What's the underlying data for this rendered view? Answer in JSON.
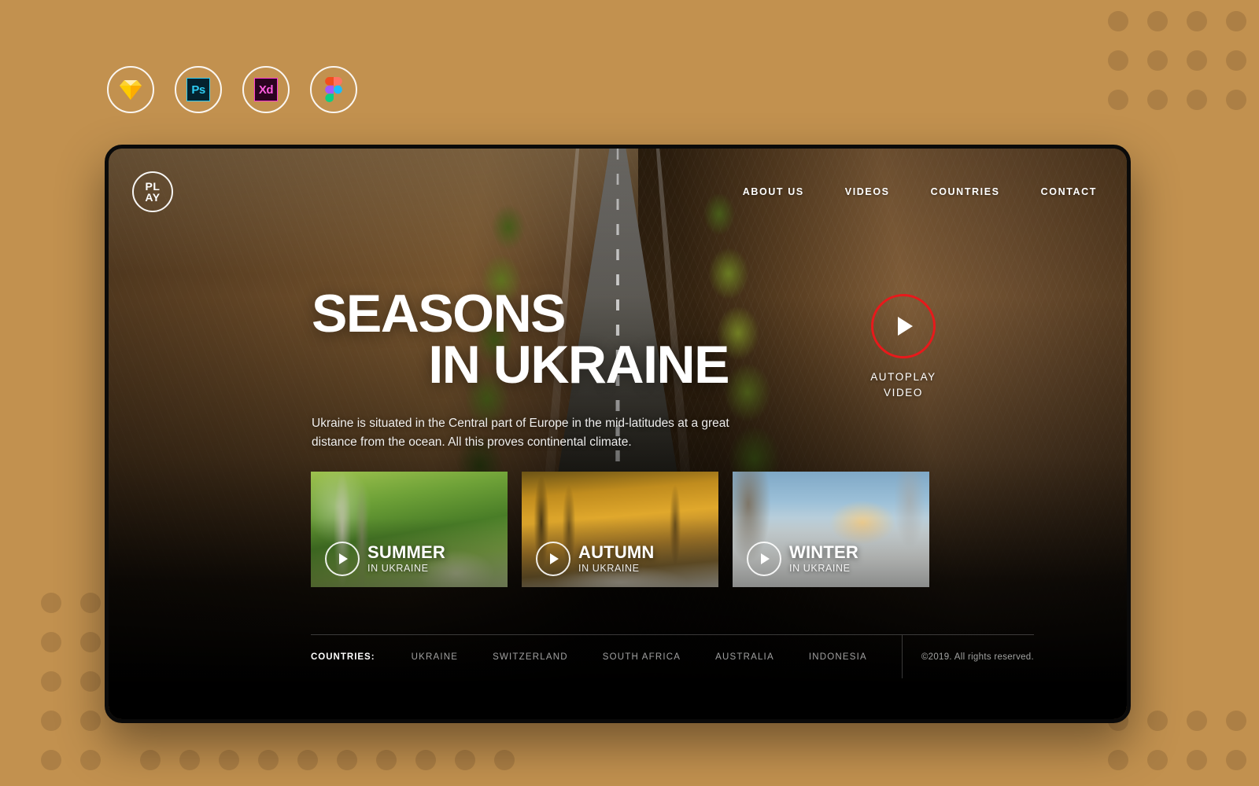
{
  "canvas": {
    "background_color": "#c2914f",
    "dot_color": "#ac7f45"
  },
  "tool_badges": [
    {
      "name": "sketch",
      "label": "Sketch"
    },
    {
      "name": "photoshop",
      "label": "Ps"
    },
    {
      "name": "adobe-xd",
      "label": "Xd"
    },
    {
      "name": "figma",
      "label": "Figma"
    }
  ],
  "site": {
    "logo": {
      "line1": "PL",
      "line2": "AY"
    },
    "nav": [
      {
        "label": "ABOUT US"
      },
      {
        "label": "VIDEOS"
      },
      {
        "label": "COUNTRIES"
      },
      {
        "label": "CONTACT"
      }
    ],
    "hero": {
      "headline_line1": "SEASONS",
      "headline_line2": "IN UKRAINE",
      "lede": "Ukraine is situated in the Central part of Europe in the mid-latitudes at a great distance from the ocean. All this proves continental climate.",
      "autoplay": {
        "label_line1": "AUTOPLAY",
        "label_line2": "VIDEO",
        "ring_color": "#e8191b"
      }
    },
    "season_cards": [
      {
        "title": "SUMMER",
        "subtitle": "IN UKRAINE",
        "key": "summer"
      },
      {
        "title": "AUTUMN",
        "subtitle": "IN UKRAINE",
        "key": "autumn"
      },
      {
        "title": "WINTER",
        "subtitle": "IN UKRAINE",
        "key": "winter"
      }
    ],
    "footer": {
      "countries_label": "COUNTRIES:",
      "countries": [
        {
          "label": "UKRAINE"
        },
        {
          "label": "SWITZERLAND"
        },
        {
          "label": "SOUTH AFRICA"
        },
        {
          "label": "AUSTRALIA"
        },
        {
          "label": "INDONESIA"
        }
      ],
      "copyright": "©2019. All rights reserved."
    }
  }
}
